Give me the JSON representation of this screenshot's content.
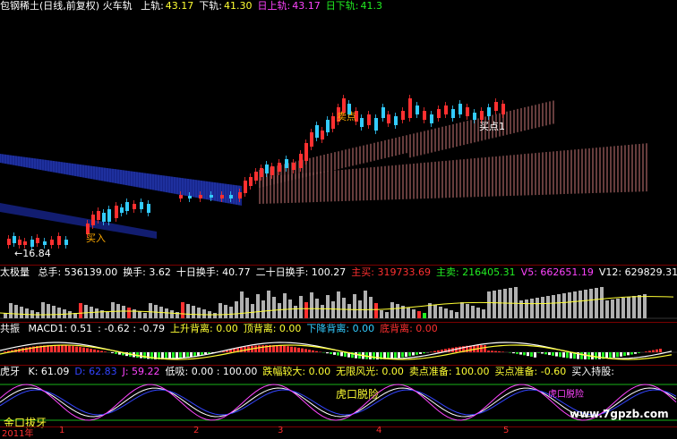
{
  "colors": {
    "red": "#ff3030",
    "cyan": "#33ccff",
    "white": "#ffffff",
    "yellow": "#ffff33",
    "magenta": "#ff44ff",
    "green": "#22ee22",
    "grey": "#b0b0b0",
    "blue": "#3344ff",
    "pink": "#ff6688",
    "orange": "#ffaa00"
  },
  "panel1": {
    "title": "包钢稀土(日线,前复权) 火车轨",
    "items": [
      {
        "label": "上轨:",
        "value": "43.17",
        "label_color": "#ffffff",
        "value_color": "#ffff33"
      },
      {
        "label": "下轨:",
        "value": "41.30",
        "label_color": "#ffffff",
        "value_color": "#ffff33"
      },
      {
        "label": "日上轨:",
        "value": "43.17",
        "label_color": "#ff44ff",
        "value_color": "#ff44ff"
      },
      {
        "label": "日下轨:",
        "value": "41.3",
        "label_color": "#22ee22",
        "value_color": "#22ee22"
      }
    ],
    "side_label": "太极量",
    "low_mark": "←16.84",
    "buy_label_left": "买入",
    "sell_label": "卖点",
    "buy_label_right": "买点1"
  },
  "panel2": {
    "items": [
      {
        "text": "总手: 536139.00",
        "color": "#ffffff"
      },
      {
        "text": "换手: 3.62",
        "color": "#ffffff"
      },
      {
        "text": "十日换手: 40.77",
        "color": "#ffffff"
      },
      {
        "text": "二十日换手: 100.27",
        "color": "#ffffff"
      },
      {
        "text": "主买: 319733.69",
        "color": "#ff3030"
      },
      {
        "text": "主卖: 216405.31",
        "color": "#22ee22"
      },
      {
        "text": "V5: 662651.19",
        "color": "#ff44ff"
      },
      {
        "text": "V12: 629829.31",
        "color": "#ffffff"
      }
    ],
    "side_label": "共振"
  },
  "panel3": {
    "items": [
      {
        "text": "MACD1: 0.51",
        "color": "#ffffff"
      },
      {
        "text": ": -0.62 : -0.79",
        "color": "#ffffff"
      },
      {
        "text": "上升背离: 0.00",
        "color": "#ffff33"
      },
      {
        "text": "顶背离: 0.00",
        "color": "#ffff33"
      },
      {
        "text": "下降背离: 0.00",
        "color": "#33ccff"
      },
      {
        "text": "底背离: 0.00",
        "color": "#ff3030"
      }
    ],
    "side_label": "虎牙"
  },
  "panel4": {
    "items": [
      {
        "text": "K: 61.09",
        "color": "#ffffff"
      },
      {
        "text": "D: 62.83",
        "color": "#3344ff"
      },
      {
        "text": "J: 59.22",
        "color": "#ff44ff"
      },
      {
        "text": "低吸: 0.00 : 100.00",
        "color": "#ffffff"
      },
      {
        "text": "跌幅较大: 0.00",
        "color": "#ffff33"
      },
      {
        "text": "无限风光: 0.00",
        "color": "#ffff33"
      },
      {
        "text": "卖点准备: 100.00",
        "color": "#ffff33"
      },
      {
        "text": "买点准备: -0.60",
        "color": "#ffff33"
      },
      {
        "text": "买入持股:",
        "color": "#ffffff"
      }
    ],
    "tiger_label": "虎口脱险",
    "tiger_label2": "虎口脱险",
    "bottom_label": "金口拔牙"
  },
  "axis": {
    "year": "2011年",
    "marks": [
      "1",
      "2",
      "3",
      "4",
      "5"
    ]
  },
  "watermark": "www.7gpzb.com"
}
